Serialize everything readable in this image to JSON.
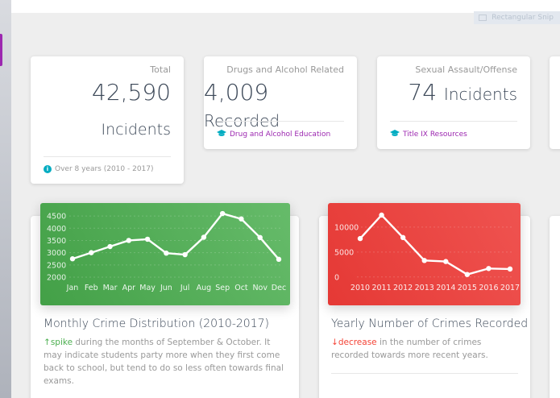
{
  "top_snip_label": "Rectangular Snip",
  "stats": [
    {
      "label": "Total",
      "value": "42,590",
      "unit": "Incidents",
      "footer": "Over 8 years (2010 - 2017)",
      "footer_icon": "info-icon"
    },
    {
      "label": "Drugs and Alcohol Related",
      "value": "4,009",
      "unit": "Recorded",
      "footer": "Drug and Alcohol Education",
      "footer_icon": "graduation-cap-icon"
    },
    {
      "label": "Sexual Assault/Offense",
      "value": "74",
      "unit": "Incidents",
      "footer": "Title IX Resources",
      "footer_icon": "graduation-cap-icon"
    }
  ],
  "charts": [
    {
      "title": "Monthly Crime Distribution (2010-2017)",
      "desc_highlight": "spike",
      "desc_text": " during the months of September & October. It may indicate students party more when they first come back to school, but tend to do so less often towards final exams.",
      "trend": "up",
      "color": "#4caf50"
    },
    {
      "title": "Yearly Number of Crimes Recorded",
      "desc_highlight": "decrease",
      "desc_text": " in the number of crimes recorded towards more recent years.",
      "trend": "down",
      "color": "#f44336"
    }
  ],
  "chart_data": [
    {
      "type": "line",
      "x": [
        "Jan",
        "Feb",
        "Mar",
        "Apr",
        "May",
        "Jun",
        "Jul",
        "Aug",
        "Sep",
        "Oct",
        "Nov",
        "Dec"
      ],
      "y": [
        2750,
        3000,
        3250,
        3500,
        3550,
        2980,
        2920,
        3630,
        4600,
        4380,
        3620,
        2730
      ],
      "yticks": [
        2000,
        2500,
        3000,
        3500,
        4000,
        4500
      ],
      "ylim": [
        2000,
        4700
      ]
    },
    {
      "type": "line",
      "x": [
        "2010",
        "2011",
        "2012",
        "2013",
        "2014",
        "2015",
        "2016",
        "2017"
      ],
      "y": [
        7700,
        12400,
        7900,
        3300,
        3100,
        500,
        1700,
        1600
      ],
      "yticks": [
        0,
        5000,
        10000
      ],
      "ylim": [
        -1000,
        13200
      ]
    }
  ]
}
